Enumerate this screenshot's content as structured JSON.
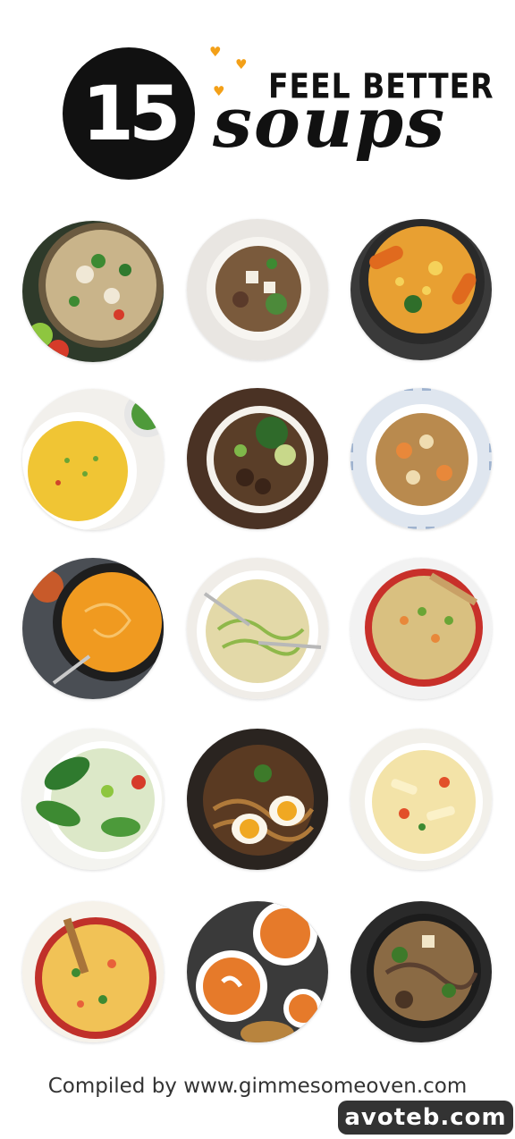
{
  "header": {
    "number": "15",
    "subtitle": "FEEL BETTER",
    "title": "soups",
    "accent_color": "#f3a018"
  },
  "footer": {
    "credit": "Compiled by www.gimmesomeoven.com"
  },
  "watermark": {
    "text": "avoteb.com"
  }
}
